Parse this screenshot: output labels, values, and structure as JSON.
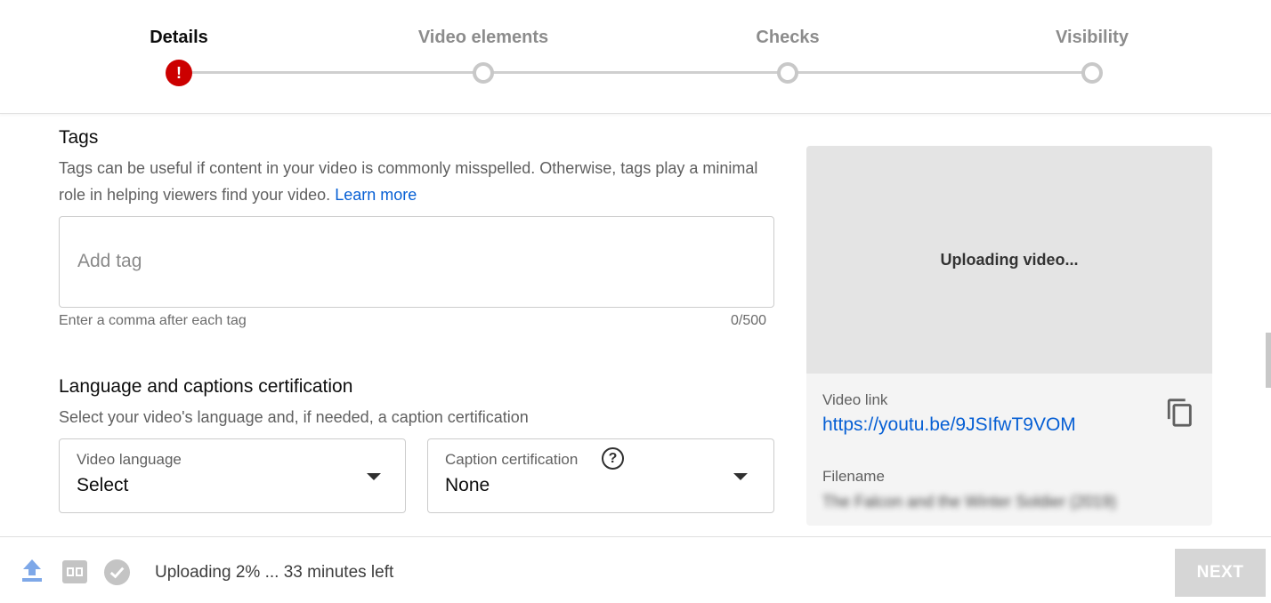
{
  "stepper": {
    "steps": [
      {
        "label": "Details",
        "state": "error",
        "error_glyph": "!"
      },
      {
        "label": "Video elements",
        "state": "pending"
      },
      {
        "label": "Checks",
        "state": "pending"
      },
      {
        "label": "Visibility",
        "state": "pending"
      }
    ]
  },
  "tags": {
    "title": "Tags",
    "description": "Tags can be useful if content in your video is commonly misspelled. Otherwise, tags play a minimal role in helping viewers find your video.",
    "learn_more": "Learn more",
    "placeholder": "Add tag",
    "value": "",
    "hint": "Enter a comma after each tag",
    "counter": "0/500"
  },
  "language": {
    "title": "Language and captions certification",
    "description": "Select your video's language and, if needed, a caption certification",
    "video_language": {
      "label": "Video language",
      "value": "Select"
    },
    "caption_certification": {
      "label": "Caption certification",
      "value": "None",
      "help_glyph": "?"
    }
  },
  "preview": {
    "status": "Uploading video...",
    "video_link_label": "Video link",
    "video_link": "https://youtu.be/9JSIfwT9VOM",
    "filename_label": "Filename",
    "filename": "The Falcon and the Winter Soldier (2019)"
  },
  "footer": {
    "status": "Uploading 2% ... 33 minutes left",
    "next_label": "NEXT",
    "upload_progress_percent": 2,
    "icons": [
      "upload-icon",
      "hd-icon",
      "check-circle-icon"
    ]
  },
  "colors": {
    "error": "#cc0000",
    "link": "#065fd4",
    "upload_icon": "#7ea8e8",
    "disabled_button": "#d6d6d6"
  }
}
